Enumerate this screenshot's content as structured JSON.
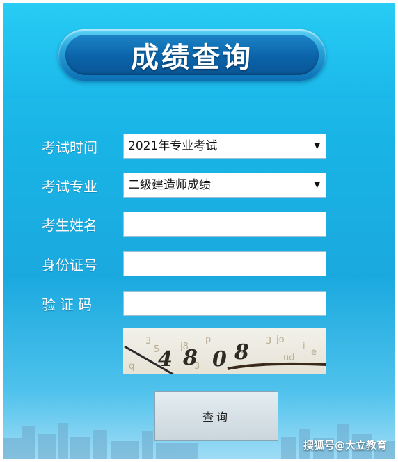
{
  "header": {
    "title": "成绩查询"
  },
  "form": {
    "exam_time": {
      "label": "考试时间",
      "value": "2021年专业考试"
    },
    "exam_major": {
      "label": "考试专业",
      "value": "二级建造师成绩"
    },
    "name": {
      "label": "考生姓名",
      "value": ""
    },
    "id_number": {
      "label": "身份证号",
      "value": ""
    },
    "captcha": {
      "label": "验证码",
      "value": "",
      "image_text": "4808"
    }
  },
  "query_button": {
    "label": "查询"
  },
  "watermark": "搜狐号@大立教育",
  "colors": {
    "background": "#1ab4e6",
    "title_pill": "#0b63a9",
    "button": "#d6e1e6"
  }
}
